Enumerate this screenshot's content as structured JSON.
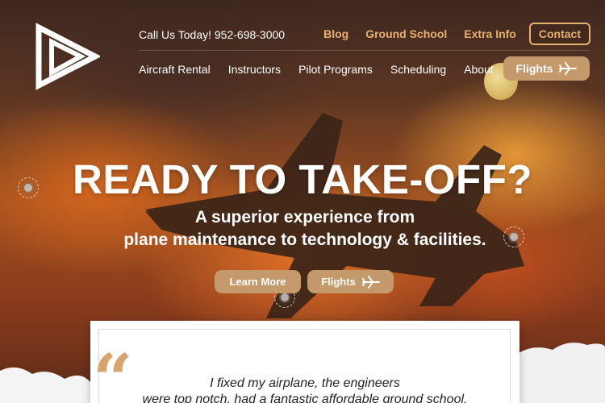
{
  "header": {
    "phone": "Call Us Today! 952-698-3000",
    "top_links": [
      "Blog",
      "Ground School",
      "Extra Info"
    ],
    "contact_label": "Contact"
  },
  "nav": {
    "items": [
      "Aircraft Rental",
      "Instructors",
      "Pilot Programs",
      "Scheduling",
      "About"
    ],
    "flights_label": "Flights"
  },
  "hero": {
    "headline": "READY TO TAKE-OFF?",
    "subline_1": "A superior experience from",
    "subline_2": "plane maintenance to technology & facilities.",
    "learn_more_label": "Learn More",
    "flights_label": "Flights"
  },
  "testimonial": {
    "quote_line_1": "I fixed my airplane, the engineers",
    "quote_line_2": "were top notch, had a fantastic affordable ground school."
  },
  "colors": {
    "accent": "#e7b070",
    "button": "#c49a6c",
    "quote": "#d9a36e"
  }
}
